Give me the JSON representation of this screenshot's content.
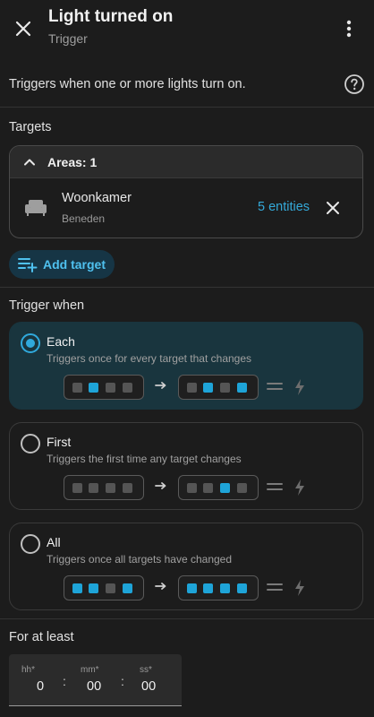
{
  "header": {
    "title": "Light turned on",
    "subtitle": "Trigger"
  },
  "description": "Triggers when one or more lights turn on.",
  "targets": {
    "section_title": "Targets",
    "areas_label": "Areas: 1",
    "area": {
      "name": "Woonkamer",
      "floor": "Beneden",
      "entities_link": "5 entities"
    },
    "add_target_label": "Add target"
  },
  "trigger_when": {
    "section_title": "Trigger when",
    "selected": "each",
    "options": [
      {
        "key": "each",
        "label": "Each",
        "description": "Triggers once for every target that changes",
        "from": [
          false,
          true,
          false,
          false
        ],
        "to": [
          false,
          true,
          false,
          true
        ]
      },
      {
        "key": "first",
        "label": "First",
        "description": "Triggers the first time any target changes",
        "from": [
          false,
          false,
          false,
          false
        ],
        "to": [
          false,
          false,
          true,
          false
        ]
      },
      {
        "key": "all",
        "label": "All",
        "description": "Triggers once all targets have changed",
        "from": [
          true,
          true,
          false,
          true
        ],
        "to": [
          true,
          true,
          true,
          true
        ]
      }
    ]
  },
  "duration": {
    "section_title": "For at least",
    "hours_label": "hh*",
    "hours_value": "0",
    "minutes_label": "mm*",
    "minutes_value": "00",
    "seconds_label": "ss*",
    "seconds_value": "00",
    "separator": ":"
  },
  "colors": {
    "accent": "#1ea4d8",
    "selected_bg": "#19353e",
    "link": "#34a9d9"
  },
  "icons": {
    "close": "close-icon",
    "more": "more-vert-icon",
    "help": "help-circle-icon",
    "chevron": "chevron-up-icon",
    "area": "sofa-icon",
    "remove": "close-icon",
    "add_target": "playlist-plus-icon",
    "arrow": "arrow-right-icon",
    "equals": "equals-icon",
    "bolt": "lightning-bolt-icon"
  }
}
